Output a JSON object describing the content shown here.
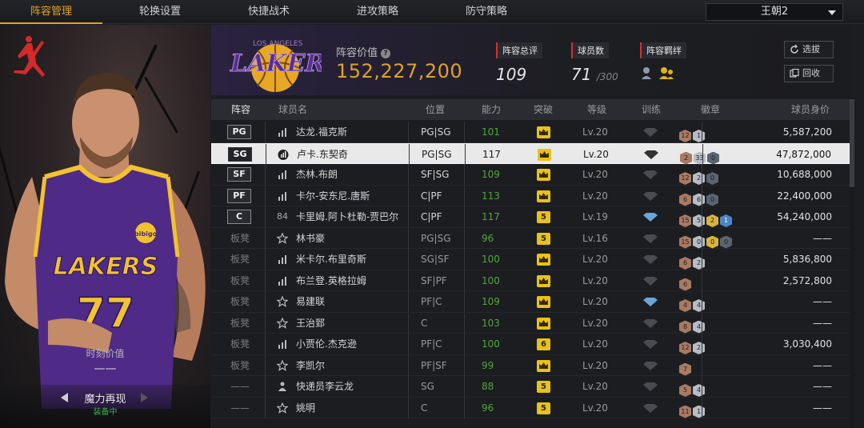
{
  "tabs": [
    "阵容管理",
    "轮换设置",
    "快捷战术",
    "进攻策略",
    "防守策略"
  ],
  "team_select": "王朝2",
  "header": {
    "team_logo_text": "LAKERS",
    "team_logo_sub": "LOS ANGELES",
    "lineup_value_label": "阵容价值",
    "lineup_value": "152,227,200",
    "rating_label": "阵容总评",
    "rating": "109",
    "player_count_label": "球员数",
    "player_count": "71",
    "player_count_max": "/300",
    "bond_label": "阵容羁绊",
    "btn_select": "选拔",
    "btn_recycle": "回收"
  },
  "left_panel": {
    "jersey_team": "LAKERS",
    "jersey_number": "77",
    "patch": "bibigo",
    "moment_label": "时刻价值",
    "moment_value": "——",
    "skin_name": "魔力再现",
    "skin_status": "装备中"
  },
  "table": {
    "headers": [
      "阵容",
      "球员名",
      "位置",
      "能力",
      "突破",
      "等级",
      "训练",
      "徽章",
      "球员身价"
    ],
    "rows": [
      {
        "slot": "PG",
        "starter": true,
        "icon": "bars",
        "name": "达龙.福克斯",
        "pos": "PG|SG",
        "ovr": "101",
        "bk": "crown",
        "lv": "Lv.20",
        "train": "gray",
        "badges": [
          [
            "bronze",
            "12"
          ],
          [
            "silver",
            "1"
          ]
        ],
        "salary": "5,587,200",
        "selected": false
      },
      {
        "slot": "SG",
        "starter": true,
        "icon": "bars",
        "name": "卢卡.东契奇",
        "pos": "PG|SG",
        "ovr": "117",
        "bk": "crown",
        "lv": "Lv.20",
        "train": "dark",
        "badges": [
          [
            "bronze",
            "2"
          ],
          [
            "silver",
            "33"
          ],
          [
            "dim",
            "0"
          ]
        ],
        "salary": "47,872,000",
        "selected": true
      },
      {
        "slot": "SF",
        "starter": true,
        "icon": "bars",
        "name": "杰林.布朗",
        "pos": "SF|SG",
        "ovr": "109",
        "bk": "crown",
        "lv": "Lv.20",
        "train": "gray",
        "badges": [
          [
            "bronze",
            "12"
          ],
          [
            "silver",
            "2"
          ],
          [
            "dim",
            "0"
          ]
        ],
        "salary": "10,688,000",
        "selected": false
      },
      {
        "slot": "PF",
        "starter": true,
        "icon": "bars",
        "name": "卡尔-安东尼.唐斯",
        "pos": "C|PF",
        "ovr": "113",
        "bk": "crown",
        "lv": "Lv.20",
        "train": "gray",
        "badges": [
          [
            "bronze",
            "6"
          ],
          [
            "silver",
            "6"
          ],
          [
            "dim",
            "0"
          ]
        ],
        "salary": "22,400,000",
        "selected": false
      },
      {
        "slot": "C",
        "starter": true,
        "icon": "84",
        "name": "卡里姆.阿卜杜勒-贾巴尔",
        "pos": "C|PF",
        "ovr": "117",
        "bk": "5",
        "lv": "Lv.19",
        "train": "blue",
        "badges": [
          [
            "bronze",
            "15"
          ],
          [
            "silver",
            "5"
          ],
          [
            "gold",
            "2"
          ],
          [
            "hof",
            "1"
          ]
        ],
        "salary": "54,240,000",
        "selected": false
      },
      {
        "slot": "板凳",
        "starter": false,
        "icon": "star",
        "name": "林书豪",
        "pos": "PG|SG",
        "ovr": "96",
        "bk": "5",
        "lv": "Lv.16",
        "train": "gray",
        "badges": [
          [
            "bronze",
            "15"
          ],
          [
            "silver",
            "0"
          ],
          [
            "gold",
            "0"
          ],
          [
            "dim",
            "0"
          ]
        ],
        "salary": "——",
        "selected": false
      },
      {
        "slot": "板凳",
        "starter": false,
        "icon": "bars",
        "name": "米卡尔.布里奇斯",
        "pos": "SG|SF",
        "ovr": "100",
        "bk": "crown",
        "lv": "Lv.20",
        "train": "gray",
        "badges": [
          [
            "bronze",
            "6"
          ],
          [
            "silver",
            "2"
          ]
        ],
        "salary": "5,836,800",
        "selected": false
      },
      {
        "slot": "板凳",
        "starter": false,
        "icon": "bars",
        "name": "布兰登.英格拉姆",
        "pos": "SF|PF",
        "ovr": "100",
        "bk": "crown",
        "lv": "Lv.20",
        "train": "gray",
        "badges": [
          [
            "bronze",
            "6"
          ]
        ],
        "salary": "2,572,800",
        "selected": false
      },
      {
        "slot": "板凳",
        "starter": false,
        "icon": "star",
        "name": "易建联",
        "pos": "PF|C",
        "ovr": "109",
        "bk": "crown",
        "lv": "Lv.20",
        "train": "blue",
        "badges": [
          [
            "bronze",
            "4"
          ],
          [
            "silver",
            "4"
          ]
        ],
        "salary": "——",
        "selected": false
      },
      {
        "slot": "板凳",
        "starter": false,
        "icon": "star",
        "name": "王治郅",
        "pos": "C",
        "ovr": "103",
        "bk": "crown",
        "lv": "Lv.20",
        "train": "gray",
        "badges": [
          [
            "bronze",
            "8"
          ],
          [
            "silver",
            "4"
          ]
        ],
        "salary": "——",
        "selected": false
      },
      {
        "slot": "板凳",
        "starter": false,
        "icon": "bars",
        "name": "小贾伦.杰克逊",
        "pos": "PF|C",
        "ovr": "100",
        "bk": "6",
        "lv": "Lv.20",
        "train": "gray",
        "badges": [
          [
            "bronze",
            "12"
          ],
          [
            "silver",
            "2"
          ]
        ],
        "salary": "3,030,400",
        "selected": false
      },
      {
        "slot": "板凳",
        "starter": false,
        "icon": "star",
        "name": "李凯尔",
        "pos": "PF|SF",
        "ovr": "99",
        "bk": "crown",
        "lv": "Lv.20",
        "train": "gray",
        "badges": [
          [
            "bronze",
            "7"
          ]
        ],
        "salary": "——",
        "selected": false
      },
      {
        "slot": "——",
        "starter": false,
        "icon": "person",
        "name": "快递员李云龙",
        "pos": "SG",
        "ovr": "88",
        "bk": "5",
        "lv": "Lv.20",
        "train": "gray",
        "badges": [
          [
            "bronze",
            "5"
          ],
          [
            "silver",
            "4"
          ]
        ],
        "salary": "——",
        "selected": false
      },
      {
        "slot": "——",
        "starter": false,
        "icon": "star",
        "name": "姚明",
        "pos": "C",
        "ovr": "96",
        "bk": "5",
        "lv": "Lv.20",
        "train": "gray",
        "badges": [
          [
            "bronze",
            "11"
          ],
          [
            "silver",
            "1"
          ]
        ],
        "salary": "——",
        "selected": false
      }
    ]
  },
  "colors": {
    "accent": "#e0a12a",
    "green": "#4ea83a",
    "purple": "#4f2a86",
    "gold": "#e8c21a"
  }
}
